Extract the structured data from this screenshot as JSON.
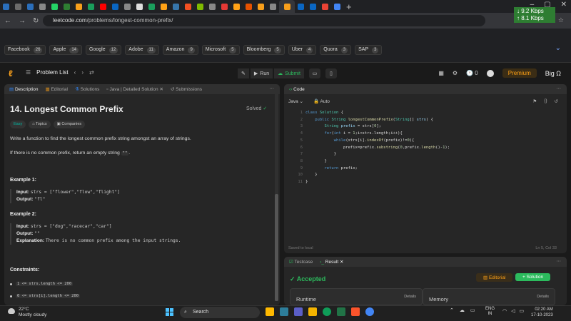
{
  "browser": {
    "tabs": [
      {
        "icon": "tab-icon",
        "color": "#2a6ebb"
      },
      {
        "icon": "tab-icon",
        "color": "#6b6b6b"
      },
      {
        "icon": "tab-icon",
        "color": "#2a6ebb"
      },
      {
        "icon": "tab-icon",
        "color": "#888"
      },
      {
        "icon": "whatsapp-icon",
        "color": "#25d366"
      },
      {
        "icon": "tab-icon",
        "color": "#2e7d32"
      },
      {
        "icon": "tab-icon",
        "color": "#f89f1b"
      },
      {
        "icon": "tab-icon",
        "color": "#1a9e5c"
      },
      {
        "icon": "youtube-icon",
        "color": "#ff0000"
      },
      {
        "icon": "linkedin-icon",
        "color": "#0a66c2"
      },
      {
        "icon": "tab-icon",
        "color": "#888"
      },
      {
        "icon": "github-icon",
        "color": "#ddd"
      },
      {
        "icon": "tab-icon",
        "color": "#1a9e5c"
      },
      {
        "icon": "tab-icon",
        "color": "#ffa116"
      },
      {
        "icon": "python-icon",
        "color": "#3776ab"
      },
      {
        "icon": "microsoft-icon",
        "color": "#f25022"
      },
      {
        "icon": "microsoft-icon",
        "color": "#7fba00"
      },
      {
        "icon": "tab-icon",
        "color": "#888"
      },
      {
        "icon": "tab-icon",
        "color": "#e53935"
      },
      {
        "icon": "tab-icon",
        "color": "#ffa116"
      },
      {
        "icon": "tab-icon",
        "color": "#e65100"
      },
      {
        "icon": "tab-icon",
        "color": "#f89f1b"
      },
      {
        "icon": "tab-icon",
        "color": "#888"
      },
      {
        "icon": "leetcode-icon",
        "color": "#f89f1b"
      },
      {
        "icon": "linkedin-icon",
        "color": "#0a66c2"
      },
      {
        "icon": "linkedin-icon",
        "color": "#0a66c2"
      },
      {
        "icon": "gmail-icon",
        "color": "#ea4335"
      },
      {
        "icon": "chrome-icon",
        "color": "#4285f4"
      }
    ],
    "network": {
      "down": "↓ 9.2 Kbps",
      "up": "↑ 8.1 Kbps"
    },
    "url_domain": "leetcode.com",
    "url_path": "/problems/longest-common-prefix/"
  },
  "bookmarks": [
    {
      "label": "Facebook",
      "count": "26"
    },
    {
      "label": "Apple",
      "count": "14"
    },
    {
      "label": "Google",
      "count": "12"
    },
    {
      "label": "Adobe",
      "count": "11"
    },
    {
      "label": "Amazon",
      "count": "9"
    },
    {
      "label": "Microsoft",
      "count": "5"
    },
    {
      "label": "Bloomberg",
      "count": "5"
    },
    {
      "label": "Uber",
      "count": "4"
    },
    {
      "label": "Quora",
      "count": "3"
    },
    {
      "label": "SAP",
      "count": "3"
    }
  ],
  "nav": {
    "problem_list": "Problem List",
    "run": "Run",
    "submit": "Submit",
    "streak": "0",
    "premium": "Premium",
    "brand": "Big Ω"
  },
  "left_tabs": {
    "description": "Description",
    "editorial": "Editorial",
    "solutions": "Solutions",
    "java": "Java | Detailed Solution",
    "submissions": "Submissions"
  },
  "problem": {
    "title": "14. Longest Common Prefix",
    "solved": "Solved",
    "tags": {
      "easy": "Easy",
      "topics": "Topics",
      "companies": "Companies"
    },
    "desc1": "Write a function to find the longest common prefix string amongst an array of strings.",
    "desc2a": "If there is no common prefix, return an empty string ",
    "desc2code": "\"\"",
    "desc2b": ".",
    "ex1": {
      "h": "Example 1:",
      "input_l": "Input:",
      "input": "strs = [\"flower\",\"flow\",\"flight\"]",
      "output_l": "Output:",
      "output": "\"fl\""
    },
    "ex2": {
      "h": "Example 2:",
      "input_l": "Input:",
      "input": "strs = [\"dog\",\"racecar\",\"car\"]",
      "output_l": "Output:",
      "output": "\"\"",
      "expl_l": "Explanation:",
      "expl": "There is no common prefix among the input strings."
    },
    "constraints_h": "Constraints:",
    "c1": "1 <= strs.length <= 200",
    "c2": "0 <= strs[i].length <= 200"
  },
  "code_panel": {
    "title": "Code",
    "lang": "Java",
    "auto": "Auto",
    "line_numbers": [
      "1",
      "2",
      "3",
      "4",
      "5",
      "6",
      "7",
      "8",
      "9",
      "10",
      "11"
    ],
    "saved": "Saved to local",
    "cursor": "Ln 5, Col 33"
  },
  "result": {
    "testcase": "Testcase",
    "result": "Result",
    "accepted": "Accepted",
    "editorial": "Editorial",
    "solution": "+ Solution",
    "runtime": "Runtime",
    "memory": "Memory",
    "details": "Details"
  },
  "taskbar": {
    "temp": "22°C",
    "weather": "Mostly cloudy",
    "search": "Search",
    "lang1": "ENG",
    "lang2": "IN",
    "time": "02:20 AM",
    "date": "17-10-2023"
  }
}
